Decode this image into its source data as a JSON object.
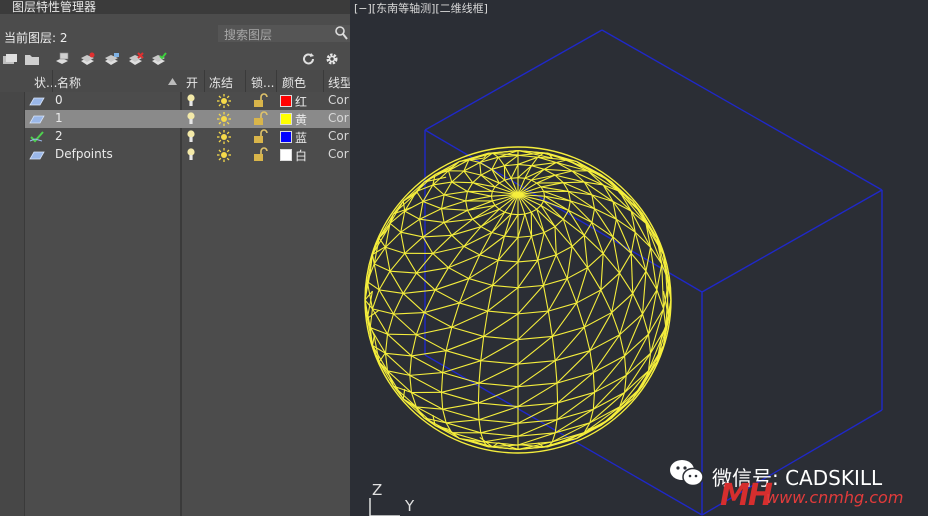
{
  "panel": {
    "title": "图层特性管理器",
    "current_layer_label": "当前图层: 2",
    "search_placeholder": "搜索图层",
    "expand_glyph": "»"
  },
  "columns": {
    "status": "状...",
    "name": "名称",
    "on": "开",
    "freeze": "冻结",
    "lock": "锁...",
    "color": "颜色",
    "linetype": "线型"
  },
  "layers": [
    {
      "name": "0",
      "status": "layer",
      "color_name": "红",
      "color_hex": "#ff0000",
      "linetype": "Cor",
      "selected": false
    },
    {
      "name": "1",
      "status": "layer",
      "color_name": "黄",
      "color_hex": "#ffff00",
      "linetype": "Cor",
      "selected": true
    },
    {
      "name": "2",
      "status": "current",
      "color_name": "蓝",
      "color_hex": "#0000ff",
      "linetype": "Cor",
      "selected": false
    },
    {
      "name": "Defpoints",
      "status": "layer",
      "color_name": "白",
      "color_hex": "#ffffff",
      "linetype": "Cor",
      "selected": false
    }
  ],
  "viewport": {
    "label": "[−][东南等轴测][二维线框]",
    "ucs_z": "Z",
    "ucs_y": "Y",
    "sphere_color": "#f5ee3c",
    "box_color": "#1f28c8"
  },
  "watermark": {
    "wechat": "微信号: CADSKILL",
    "logo_text": "MH",
    "url": "www.cnmhg.com"
  }
}
